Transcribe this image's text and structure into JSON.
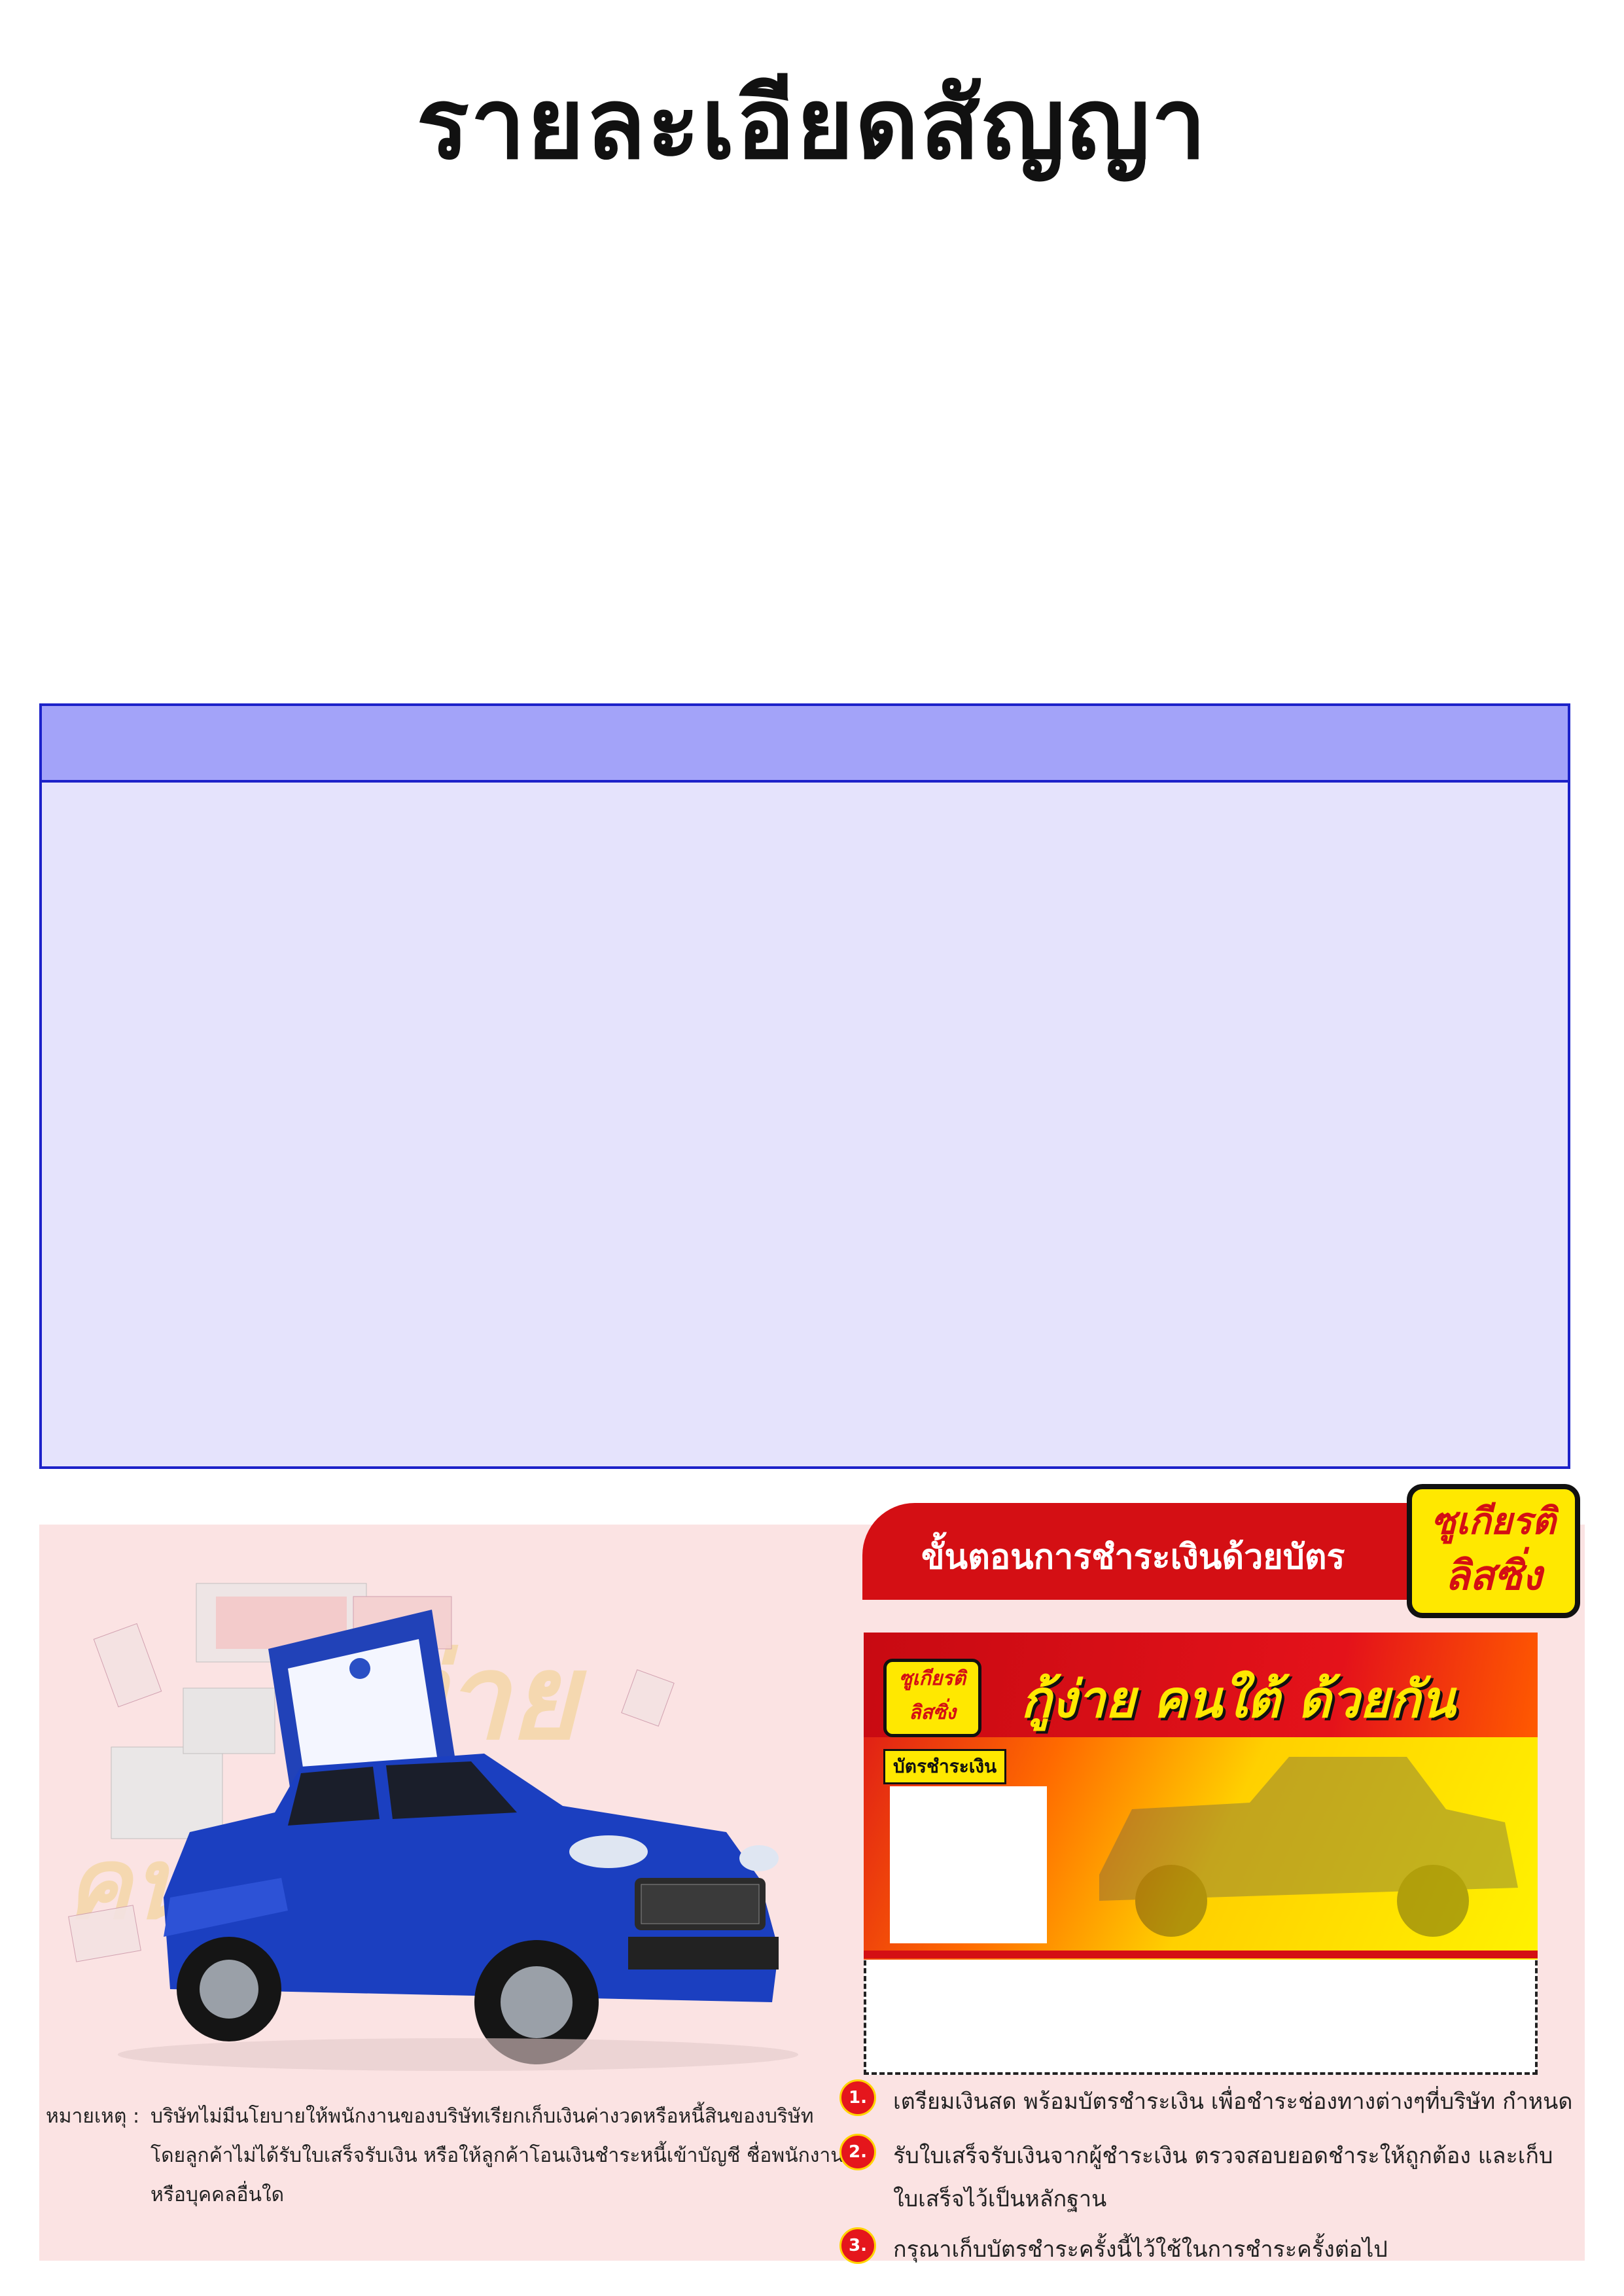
{
  "title": "รายละเอียดสัญญา",
  "watermark": {
    "line1": "กู้ง่าย",
    "line2": "คนใต้ด้วยกัน"
  },
  "note": {
    "label": "หมายเหตุ :",
    "lines": [
      "บริษัทไม่มีนโยบายให้พนักงานของบริษัทเรียกเก็บเงินค่างวดหรือหนี้สินของบริษัท",
      "โดยลูกค้าไม่ได้รับใบเสร็จรับเงิน หรือให้ลูกค้าโอนเงินชำระหนี้เข้าบัญชี ชื่อพนักงาน",
      "หรือบุคคลอื่นใด"
    ]
  },
  "steps": {
    "header": "ขั้นตอนการชำระเงินด้วยบัตร",
    "items": [
      {
        "num": "1.",
        "text": "เตรียมเงินสด พร้อมบัตรชำระเงิน เพื่อชำระช่องทางต่างๆที่บริษัท กำหนด",
        "text2": ""
      },
      {
        "num": "2.",
        "text": "รับใบเสร็จรับเงินจากผู้ชำระเงิน ตรวจสอบยอดชำระให้ถูกต้อง และเก็บ",
        "text2": "ใบเสร็จไว้เป็นหลักฐาน"
      },
      {
        "num": "3.",
        "text": "กรุณาเก็บบัตรชำระครั้งนี้ไว้ใช้ในการชำระครั้งต่อไป",
        "text2": ""
      }
    ]
  },
  "logo": {
    "line1": "ซูเกียรติ",
    "line2": "ลิสซิ่ง"
  },
  "card": {
    "logo_line1": "ซูเกียรติ",
    "logo_line2": "ลิสซิ่ง",
    "slogan": "กู้ง่าย คนใต้ ด้วยกัน",
    "label": "บัตรชำระเงิน"
  },
  "colors": {
    "accent_red": "#d40f14",
    "brand_yellow": "#ffe800",
    "box_blue": "#1d22c9"
  }
}
